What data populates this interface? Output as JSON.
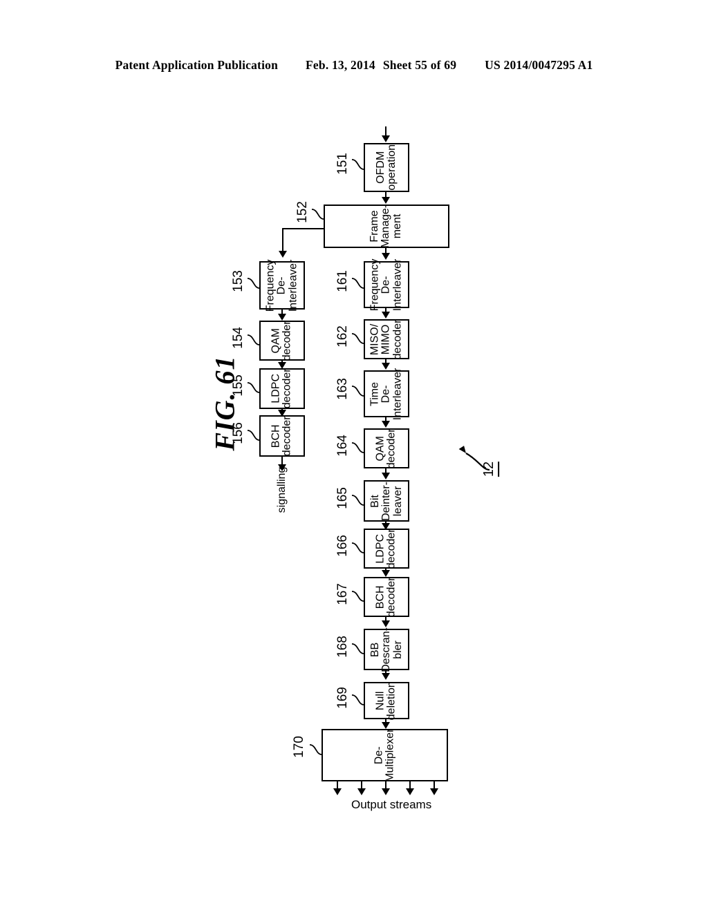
{
  "header": {
    "publication": "Patent Application Publication",
    "date": "Feb. 13, 2014",
    "sheet": "Sheet 55 of 69",
    "patent_number": "US 2014/0047295 A1"
  },
  "figure": {
    "title": "FIG. 61",
    "system_ref": "12",
    "signalling_label": "signalling",
    "output_label": "Output streams"
  },
  "blocks": {
    "b151": {
      "ref": "151",
      "line1": "OFDM",
      "line2": "operation",
      "line3": ""
    },
    "b152": {
      "ref": "152",
      "line1": "Frame",
      "line2": "Manage-",
      "line3": "ment"
    },
    "b153": {
      "ref": "153",
      "line1": "Frequency",
      "line2": "De-",
      "line3": "Interleaver"
    },
    "b154": {
      "ref": "154",
      "line1": "QAM",
      "line2": "decoder",
      "line3": ""
    },
    "b155": {
      "ref": "155",
      "line1": "LDPC",
      "line2": "decoder",
      "line3": ""
    },
    "b156": {
      "ref": "156",
      "line1": "BCH",
      "line2": "decoder",
      "line3": ""
    },
    "b161": {
      "ref": "161",
      "line1": "Frequency",
      "line2": "De-",
      "line3": "Interleaver"
    },
    "b162": {
      "ref": "162",
      "line1": "MISO/",
      "line2": "MIMO",
      "line3": "decoder"
    },
    "b163": {
      "ref": "163",
      "line1": "Time",
      "line2": "De-",
      "line3": "Interleaver"
    },
    "b164": {
      "ref": "164",
      "line1": "QAM",
      "line2": "decoder",
      "line3": ""
    },
    "b165": {
      "ref": "165",
      "line1": "Bit",
      "line2": "Deinter-",
      "line3": "leaver"
    },
    "b166": {
      "ref": "166",
      "line1": "LDPC",
      "line2": "decoder",
      "line3": ""
    },
    "b167": {
      "ref": "167",
      "line1": "BCH",
      "line2": "decoder",
      "line3": ""
    },
    "b168": {
      "ref": "168",
      "line1": "BB",
      "line2": "Descran-",
      "line3": "bler"
    },
    "b169": {
      "ref": "169",
      "line1": "Null",
      "line2": "deletion",
      "line3": ""
    },
    "b170": {
      "ref": "170",
      "line1": "De-",
      "line2": "Multiplexer",
      "line3": ""
    }
  }
}
